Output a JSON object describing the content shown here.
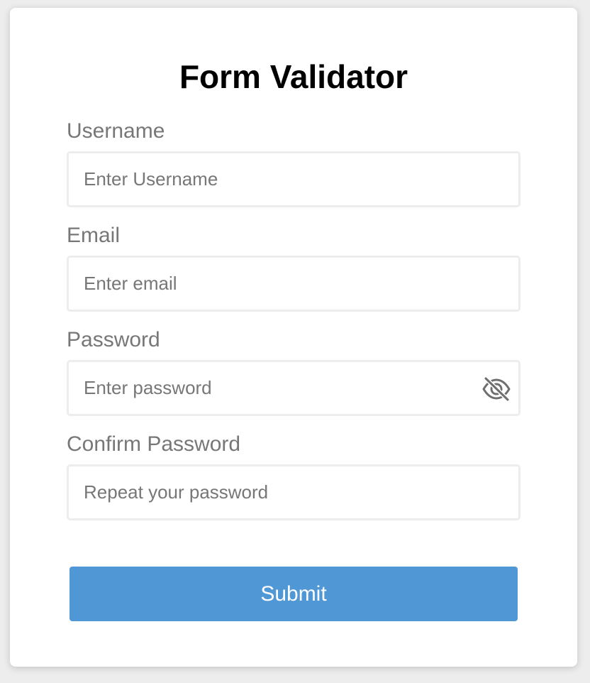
{
  "form": {
    "title": "Form Validator",
    "fields": [
      {
        "label": "Username",
        "placeholder": "Enter Username",
        "value": ""
      },
      {
        "label": "Email",
        "placeholder": "Enter email",
        "value": ""
      },
      {
        "label": "Password",
        "placeholder": "Enter password",
        "value": "",
        "toggle_icon": "eye-slash-icon"
      },
      {
        "label": "Confirm Password",
        "placeholder": "Repeat your password",
        "value": ""
      }
    ],
    "submit_label": "Submit"
  },
  "colors": {
    "background": "#ededed",
    "card": "#ffffff",
    "label_text": "#777777",
    "input_border": "#ededed",
    "submit_button": "#5098d5",
    "submit_text": "#ffffff"
  }
}
